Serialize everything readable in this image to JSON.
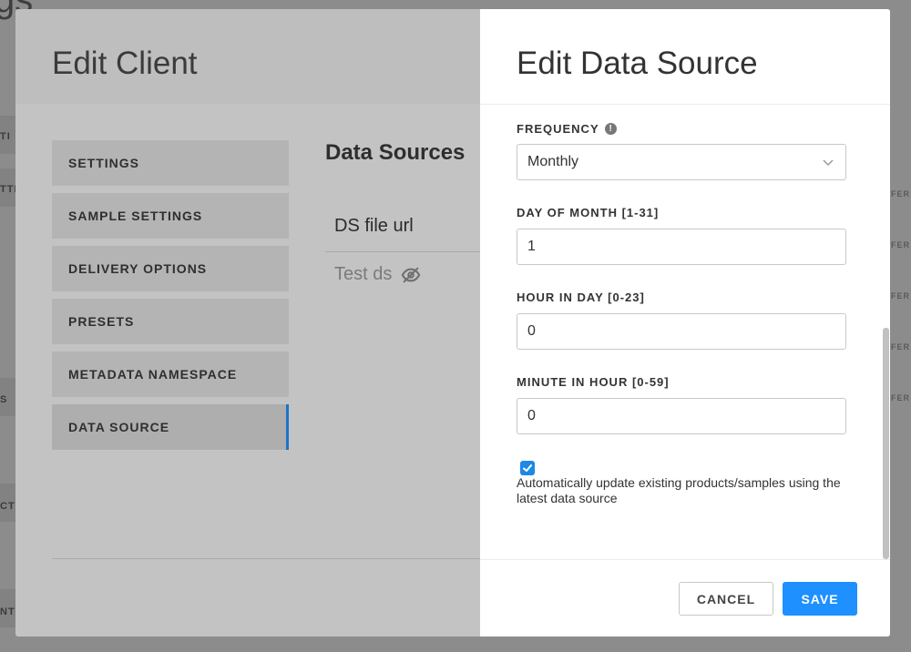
{
  "background": {
    "title_fragment": "gs",
    "left_labels": [
      "TI",
      "TTI",
      "S",
      "CTI",
      "NT"
    ],
    "right_labels": [
      "FER",
      "FER",
      "FER",
      "FER",
      "FER"
    ]
  },
  "edit_client": {
    "title": "Edit Client",
    "nav_items": [
      {
        "label": "SETTINGS"
      },
      {
        "label": "SAMPLE SETTINGS"
      },
      {
        "label": "DELIVERY OPTIONS"
      },
      {
        "label": "PRESETS"
      },
      {
        "label": "METADATA NAMESPACE"
      },
      {
        "label": "DATA SOURCE"
      }
    ],
    "active_nav": "DATA SOURCE",
    "data_sources_heading": "Data Sources",
    "data_sources": [
      {
        "name": "DS file url"
      },
      {
        "name": "Test ds",
        "icon": "eye-off-icon"
      }
    ]
  },
  "edit_data_source": {
    "title": "Edit Data Source",
    "frequency": {
      "label": "FREQUENCY",
      "value": "Monthly",
      "info_icon": "info-icon"
    },
    "day_of_month": {
      "label": "DAY OF MONTH [1-31]",
      "value": "1"
    },
    "hour_in_day": {
      "label": "HOUR IN DAY [0-23]",
      "value": "0"
    },
    "minute_in_hour": {
      "label": "MINUTE IN HOUR [0-59]",
      "value": "0"
    },
    "auto_update": {
      "checked": true,
      "label": "Automatically update existing products/samples using the latest data source"
    },
    "buttons": {
      "cancel": "CANCEL",
      "save": "SAVE"
    }
  },
  "colors": {
    "accent": "#1e90ff",
    "active_indicator": "#1a74c9",
    "overlay": "#8c8c8c"
  }
}
